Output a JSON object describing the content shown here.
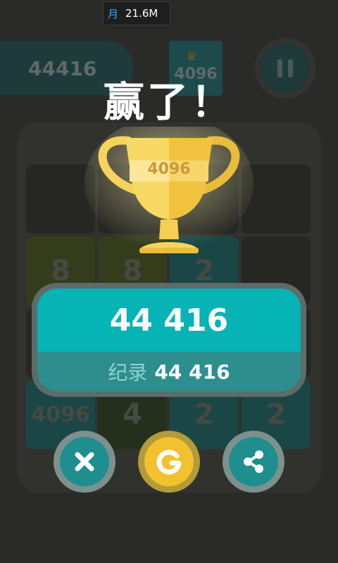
{
  "status_bar": {
    "app_glyph": "月",
    "memory": "21.6M"
  },
  "header": {
    "score_value": "44416",
    "best_tile_value": "4096",
    "pause_icon": "pause-icon"
  },
  "board": {
    "tiles": [
      {
        "value": "",
        "color": "#262623"
      },
      {
        "value": "",
        "color": "#262623"
      },
      {
        "value": "",
        "color": "#262623"
      },
      {
        "value": "",
        "color": "#262623"
      },
      {
        "value": "8",
        "color": "#343c1c"
      },
      {
        "value": "8",
        "color": "#343c1c"
      },
      {
        "value": "2",
        "color": "#1a4646"
      },
      {
        "value": "",
        "color": "#262623"
      },
      {
        "value": "",
        "color": "#262623"
      },
      {
        "value": "",
        "color": "#262623"
      },
      {
        "value": "",
        "color": "#262623"
      },
      {
        "value": "",
        "color": "#262623"
      },
      {
        "value": "4096",
        "color": "#1a4646"
      },
      {
        "value": "4",
        "color": "#24301c"
      },
      {
        "value": "2",
        "color": "#1a4646"
      },
      {
        "value": "2",
        "color": "#1a4646"
      }
    ]
  },
  "win": {
    "title": "赢了！",
    "trophy_label": "4096"
  },
  "score_card": {
    "score": "44 416",
    "best_label": "纪录",
    "best_value": "44 416"
  },
  "actions": {
    "close_icon": "close-icon",
    "restart_icon": "restart-icon",
    "share_icon": "share-icon"
  },
  "colors": {
    "teal": "#06b3b5",
    "gold": "#f2c12e",
    "background": "#2a2a28"
  }
}
